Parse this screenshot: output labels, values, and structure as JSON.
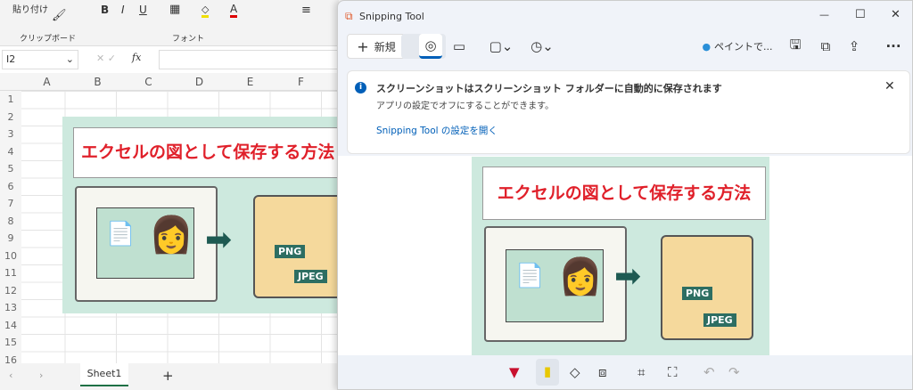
{
  "excel": {
    "ribbon": {
      "paste": "貼り付け",
      "clipboard_group": "クリップボード",
      "font_group": "フォント",
      "bold": "B",
      "italic": "I",
      "underline": "U"
    },
    "name_box": "I2",
    "fx": "fx",
    "columns": [
      "A",
      "B",
      "C",
      "D",
      "E",
      "F"
    ],
    "rows": [
      "1",
      "2",
      "3",
      "4",
      "5",
      "6",
      "7",
      "8",
      "9",
      "10",
      "11",
      "12",
      "13",
      "14",
      "15",
      "16"
    ],
    "image_title": "エクセルの図として保存する方法",
    "png_label": "PNG",
    "jpeg_label": "JPEG",
    "sheet_tab": "Sheet1",
    "add_sheet": "+"
  },
  "snip": {
    "title": "Snipping Tool",
    "new_label": "新規",
    "paint_label": "ペイントで...",
    "notice": {
      "title": "スクリーンショットはスクリーンショット フォルダーに自動的に保存されます",
      "body": "アプリの設定でオフにすることができます。",
      "link": "Snipping Tool の設定を開く"
    },
    "image_title": "エクセルの図として保存する方法",
    "png_label": "PNG",
    "jpeg_label": "JPEG",
    "accent": "#005fb8"
  }
}
